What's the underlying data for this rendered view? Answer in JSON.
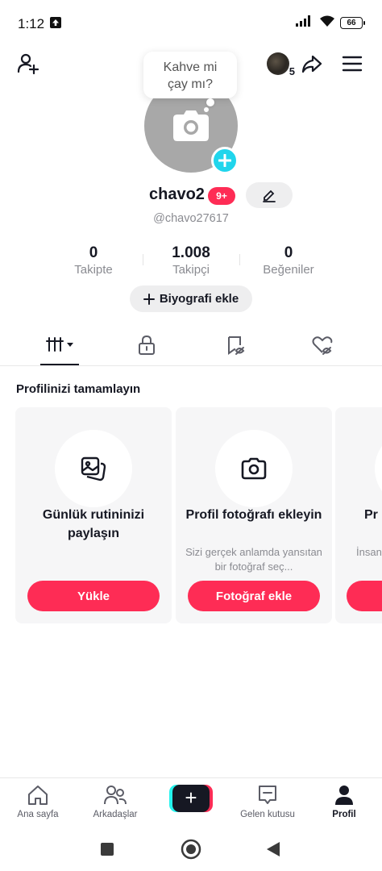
{
  "status_bar": {
    "time": "1:12",
    "battery": "66"
  },
  "profile": {
    "bubble_line1": "Kahve mi",
    "bubble_line2": "çay mı?",
    "username": "chavo2",
    "notification_badge": "9+",
    "handle": "@chavo27617",
    "friends_count": "5"
  },
  "stats": [
    {
      "value": "0",
      "label": "Takipte"
    },
    {
      "value": "1.008",
      "label": "Takipçi"
    },
    {
      "value": "0",
      "label": "Beğeniler"
    }
  ],
  "bio_button": "Biyografi ekle",
  "section_title": "Profilinizi tamamlayın",
  "cards": [
    {
      "title": "Günlük rutininizi paylaşın",
      "description": "",
      "button": "Yükle"
    },
    {
      "title": "Profil fotoğrafı ekleyin",
      "description": "Sizi gerçek anlamda yansıtan bir fotoğraf seç...",
      "button": "Fotoğraf ekle"
    },
    {
      "title": "Pr",
      "description": "İnsan",
      "button": ""
    }
  ],
  "bottom_nav": {
    "home": "Ana sayfa",
    "friends": "Arkadaşlar",
    "inbox": "Gelen kutusu",
    "profile": "Profil"
  },
  "colors": {
    "accent": "#fe2c55",
    "cyan": "#20d5ec",
    "text": "#161823",
    "muted": "#8a8b91"
  }
}
